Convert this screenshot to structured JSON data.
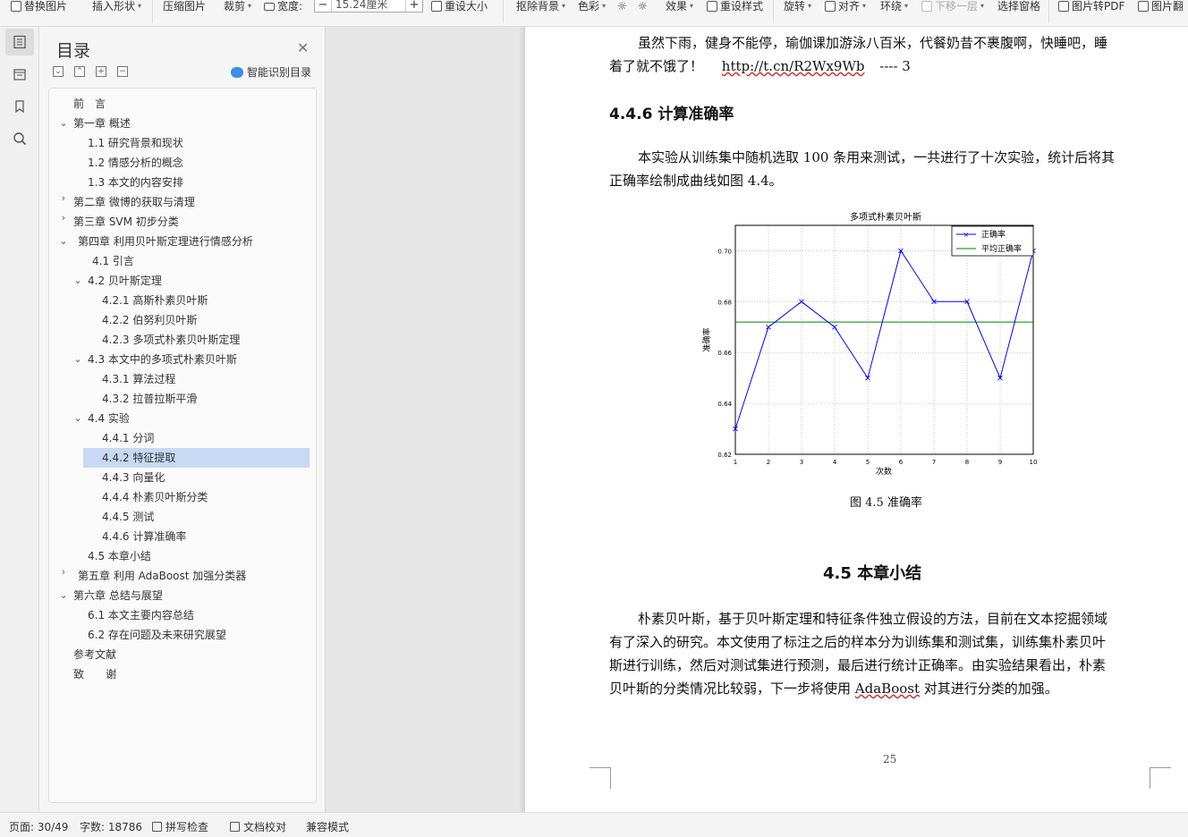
{
  "toolbar": {
    "replace_image": "替换图片",
    "insert_shape": "插入形状",
    "compress_image": "压缩图片",
    "crop": "裁剪",
    "width_label": "宽度:",
    "width_value": "15.24厘米",
    "reset_size": "重设大小",
    "remove_bg": "抠除背景",
    "color": "色彩",
    "effects": "效果",
    "reset_style": "重设样式",
    "rotate": "旋转",
    "align": "对齐",
    "wrap": "环绕",
    "move_down": "下移一层",
    "select_pane": "选择窗格",
    "image_to_pdf": "图片转PDF",
    "image_translate": "图片翻"
  },
  "toc": {
    "title": "目录",
    "smart_label": "智能识别目录",
    "items": [
      {
        "label": "前　言"
      },
      {
        "label": "第一章  概述"
      },
      {
        "label": "1.1  研究背景和现状"
      },
      {
        "label": "1.2  情感分析的概念"
      },
      {
        "label": "1.3  本文的内容安排"
      },
      {
        "label": "第二章  微博的获取与清理"
      },
      {
        "label": "第三章  SVM 初步分类"
      },
      {
        "label": "第四章  利用贝叶斯定理进行情感分析"
      },
      {
        "label": "4.1  引言"
      },
      {
        "label": "4.2  贝叶斯定理"
      },
      {
        "label": "4.2.1  高斯朴素贝叶斯"
      },
      {
        "label": "4.2.2  伯努利贝叶斯"
      },
      {
        "label": "4.2.3  多项式朴素贝叶斯定理"
      },
      {
        "label": "4.3  本文中的多项式朴素贝叶斯"
      },
      {
        "label": "4.3.1  算法过程"
      },
      {
        "label": "4.3.2  拉普拉斯平滑"
      },
      {
        "label": "4.4  实验"
      },
      {
        "label": "4.4.1  分词"
      },
      {
        "label": "4.4.2  特征提取"
      },
      {
        "label": "4.4.3  向量化"
      },
      {
        "label": "4.4.4  朴素贝叶斯分类"
      },
      {
        "label": "4.4.5  测试"
      },
      {
        "label": "4.4.6  计算准确率"
      },
      {
        "label": "4.5  本章小结"
      },
      {
        "label": "第五章  利用 AdaBoost 加强分类器"
      },
      {
        "label": "第六章  总结与展望"
      },
      {
        "label": "6.1  本文主要内容总结"
      },
      {
        "label": "6.2  存在问题及未来研究展望"
      },
      {
        "label": "参考文献"
      },
      {
        "label": "致　　谢"
      }
    ]
  },
  "document": {
    "para1_line1": "虽然下雨，健身不能停，瑜伽课加游泳八百米，代餐奶昔不裹腹啊，快睡吧，睡",
    "para1_line2_text": "着了就不饿了！",
    "para1_link": "http://t.cn/R2Wx9Wb",
    "para1_tail": "----  3",
    "heading_446": "4.4.6  计算准确率",
    "para2_line1": "本实验从训练集中随机选取 100 条用来测试，一共进行了十次实验，统计后将其",
    "para2_line2": "正确率绘制成曲线如图 4.4。",
    "figure_caption": "图 4.5  准确率",
    "heading_45": "4.5  本章小结",
    "para3_line1": "朴素贝叶斯，基于贝叶斯定理和特征条件独立假设的方法，目前在文本挖掘领域",
    "para3_line2": "有了深入的研究。本文使用了标注之后的样本分为训练集和测试集，训练集朴素贝叶",
    "para3_line3": "斯进行训练，然后对测试集进行预测，最后进行统计正确率。由实验结果看出，朴素",
    "para3_line4_a": "贝叶斯的分类情况比较弱，下一步将使用",
    "para3_line4_b": "AdaBoost",
    "para3_line4_c": "对其进行分类的加强。",
    "page_number": "25"
  },
  "status": {
    "page": "页面: 30/49",
    "words": "字数: 18786",
    "spell": "拼写检查",
    "proof": "文档校对",
    "compat": "兼容模式"
  },
  "chart_data": {
    "type": "line",
    "title": "多项式朴素贝叶斯",
    "xlabel": "次数",
    "ylabel": "准确率",
    "x": [
      1,
      2,
      3,
      4,
      5,
      6,
      7,
      8,
      9,
      10
    ],
    "series": [
      {
        "name": "正确率",
        "values": [
          0.63,
          0.67,
          0.68,
          0.67,
          0.65,
          0.7,
          0.68,
          0.68,
          0.65,
          0.7
        ],
        "color": "#0000ff",
        "marker": "x"
      },
      {
        "name": "平均正确率",
        "values": [
          0.672,
          0.672,
          0.672,
          0.672,
          0.672,
          0.672,
          0.672,
          0.672,
          0.672,
          0.672
        ],
        "color": "#008000"
      }
    ],
    "xlim": [
      1,
      10
    ],
    "ylim": [
      0.62,
      0.71
    ],
    "yticks": [
      "0.62",
      "0.64",
      "0.66",
      "0.68",
      "0.70"
    ],
    "xticks": [
      "1",
      "2",
      "3",
      "4",
      "5",
      "6",
      "7",
      "8",
      "9",
      "10"
    ],
    "grid": true,
    "legend": "top-right"
  }
}
